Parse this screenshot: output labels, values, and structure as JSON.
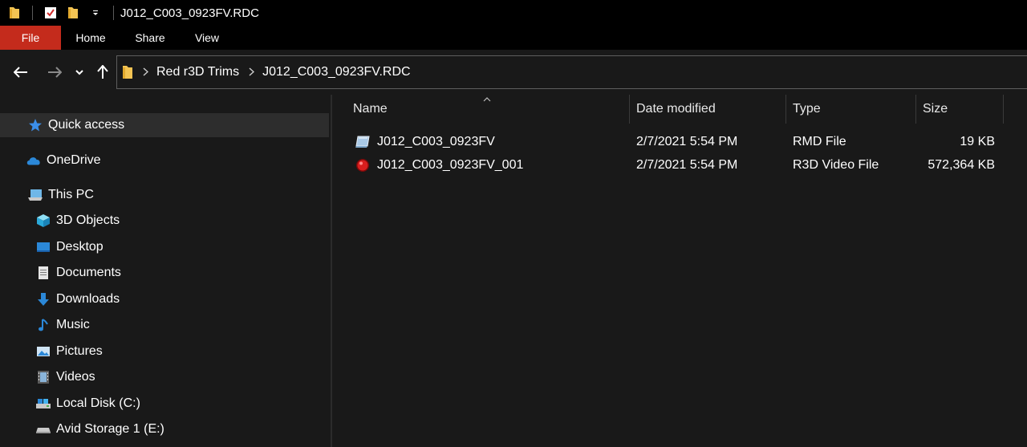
{
  "window": {
    "title": "J012_C003_0923FV.RDC"
  },
  "ribbon": {
    "tabs": [
      "File",
      "Home",
      "Share",
      "View"
    ]
  },
  "address": {
    "breadcrumbs": [
      "Red r3D Trims",
      "J012_C003_0923FV.RDC"
    ]
  },
  "sidebar": {
    "items": [
      {
        "label": "Quick access",
        "icon": "star-icon"
      },
      {
        "label": "OneDrive",
        "icon": "cloud-icon"
      },
      {
        "label": "This PC",
        "icon": "computer-icon"
      },
      {
        "label": "3D Objects",
        "icon": "cube-icon"
      },
      {
        "label": "Desktop",
        "icon": "desktop-icon"
      },
      {
        "label": "Documents",
        "icon": "document-icon"
      },
      {
        "label": "Downloads",
        "icon": "download-arrow-icon"
      },
      {
        "label": "Music",
        "icon": "music-note-icon"
      },
      {
        "label": "Pictures",
        "icon": "picture-icon"
      },
      {
        "label": "Videos",
        "icon": "film-icon"
      },
      {
        "label": "Local Disk (C:)",
        "icon": "drive-icon"
      },
      {
        "label": "Avid Storage 1 (E:)",
        "icon": "drive-icon"
      }
    ]
  },
  "columns": {
    "name": "Name",
    "date": "Date modified",
    "type": "Type",
    "size": "Size"
  },
  "files": [
    {
      "name": "J012_C003_0923FV",
      "date": "2/7/2021 5:54 PM",
      "type": "RMD File",
      "size": "19 KB",
      "icon": "rmd-file-icon"
    },
    {
      "name": "J012_C003_0923FV_001",
      "date": "2/7/2021 5:54 PM",
      "type": "R3D Video File",
      "size": "572,364 KB",
      "icon": "r3d-file-icon"
    }
  ],
  "colors": {
    "file_tab": "#c42b1c",
    "background": "#191919",
    "titlebar": "#000000",
    "selected_item": "#2d2d2d"
  }
}
